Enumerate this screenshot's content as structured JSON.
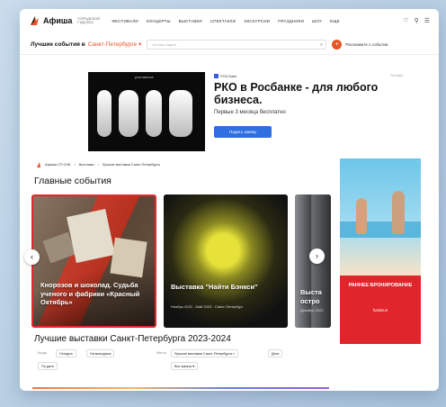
{
  "header": {
    "logo_text": "Афиша",
    "city_note": "ГОРОДСКОЙ ГИД МСК",
    "nav": [
      "Фестивали",
      "Концерты",
      "Выставки",
      "Спектакли",
      "Экскурсии",
      "Праздники",
      "Шоу",
      "Еще"
    ],
    "tools": [
      "♡",
      "⚲",
      "☰"
    ]
  },
  "subheader": {
    "best_label": "Лучшие события в",
    "city": "Санкт-Петербурге ▾",
    "search_placeholder": "Что вас ищете",
    "tell_label": "Расскажите о событии"
  },
  "top_ad": {
    "image_label": "рекламные",
    "brand": "РСБ Банк",
    "title": "РКО в Росбанке - для любого бизнеса.",
    "subtitle": "Первые 3 месяца бесплатно",
    "button": "Подать заявку",
    "ad_mark": "Реклама"
  },
  "breadcrumb": [
    "Афиша СП СНБ",
    "Выставки",
    "Лучшие выставки Санкт-Петербурга"
  ],
  "main_heading": "Главные события",
  "cards": [
    {
      "title": "Кнорозов и шоколад. Судьба ученого и фабрики «Красный Октябрь»",
      "meta": ""
    },
    {
      "title": "Выставка \"Найти Бэнкси\"",
      "meta": "Ноябрь 2022 - Май 2023 · Санкт-Петербург"
    },
    {
      "title": "Выста остро",
      "meta": "Декабрь 2022"
    }
  ],
  "side_ad": {
    "title": "РАННЕЕ БРОНИРОВАНИЕ",
    "brand": "fun&sun",
    "ad_mark": "i"
  },
  "best_heading": "Лучшие выставки Санкт-Петербурга 2023-2024",
  "filters": {
    "when_label": "Когда",
    "today": "Сегодня",
    "weekend": "На выходных",
    "date": "По дате",
    "where_label": "Место",
    "place": "Лучшие выставки Санкт-Петербурга ×",
    "extra": "Дети",
    "all": "Все жанры ▾"
  },
  "colors": {
    "accent": "#e55527",
    "ad_blue": "#2f6fe0",
    "highlight": "#e3282d"
  }
}
